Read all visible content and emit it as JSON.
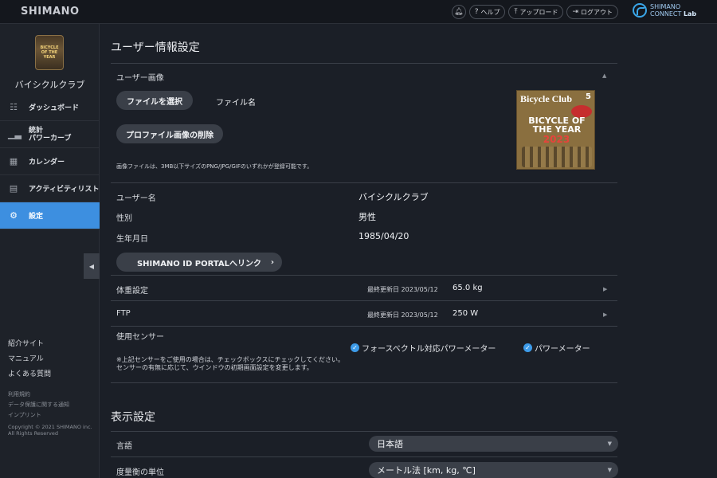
{
  "header": {
    "brand": "SHIMANO",
    "actions": [
      {
        "label": ""
      },
      {
        "label": "ヘルプ"
      },
      {
        "label": "アップロード"
      },
      {
        "label": "ログアウト"
      }
    ],
    "connect_line1": "SHIMANO",
    "connect_line2a": "CONNECT",
    "connect_line2b": "Lab"
  },
  "sidebar": {
    "logo_line1": "BICYCLE",
    "logo_line2": "OF THE YEAR",
    "club_name": "バイシクルクラブ",
    "items": [
      {
        "label": "ダッシュボード",
        "icon": "dashboard-icon"
      },
      {
        "label_line1": "統計",
        "label_line2": "パワーカーブ",
        "icon": "stats-icon"
      },
      {
        "label": "カレンダー",
        "icon": "calendar-icon"
      },
      {
        "label": "アクティビティリスト",
        "icon": "activity-list-icon"
      },
      {
        "label": "設定",
        "icon": "gear-icon"
      }
    ],
    "links": [
      "紹介サイト",
      "マニュアル",
      "よくある質問"
    ],
    "legal": [
      "利用規約",
      "データ保護に関する通知",
      "インプリント"
    ],
    "copyright_line1": "Copyright © 2021 SHIMANO inc.",
    "copyright_line2": "All Rights Reserved"
  },
  "user_settings": {
    "title": "ユーザー情報設定",
    "image_section": "ユーザー画像",
    "choose_file": "ファイルを選択",
    "file_name": "ファイル名",
    "delete_image": "プロファイル画像の削除",
    "image_note": "画像ファイルは、3MB以下サイズのPNG/JPG/GIFのいずれかが登録可能です。",
    "cover": {
      "title": "Bicycle Club",
      "issue": "5",
      "headline": "BICYCLE OF THE YEAR",
      "year": "2023"
    },
    "username_label": "ユーザー名",
    "username": "バイシクルクラブ",
    "gender_label": "性別",
    "gender": "男性",
    "birthday_label": "生年月日",
    "birthday": "1985/04/20",
    "portal_link": "SHIMANO ID PORTALへリンク",
    "weight_label": "体重設定",
    "weight_updated_label": "最終更新日",
    "weight_updated": "2023/05/12",
    "weight": "65.0 kg",
    "ftp_label": "FTP",
    "ftp_updated_label": "最終更新日",
    "ftp_updated": "2023/05/12",
    "ftp": "250 W",
    "sensor_label": "使用センサー",
    "sensor_options": [
      {
        "label": "フォースベクトル対応パワーメーター",
        "checked": true
      },
      {
        "label": "パワーメーター",
        "checked": true
      }
    ],
    "sensor_note_line1": "※上記センサーをご使用の場合は、チェックボックスにチェックしてください。",
    "sensor_note_line2": "センサーの有無に応じて、ウインドウの初期画面設定を変更します。"
  },
  "display_settings": {
    "title": "表示設定",
    "language_label": "言語",
    "language": "日本語",
    "units_label": "度量衡の単位",
    "units": "メートル法 [km, kg, ℃]"
  }
}
